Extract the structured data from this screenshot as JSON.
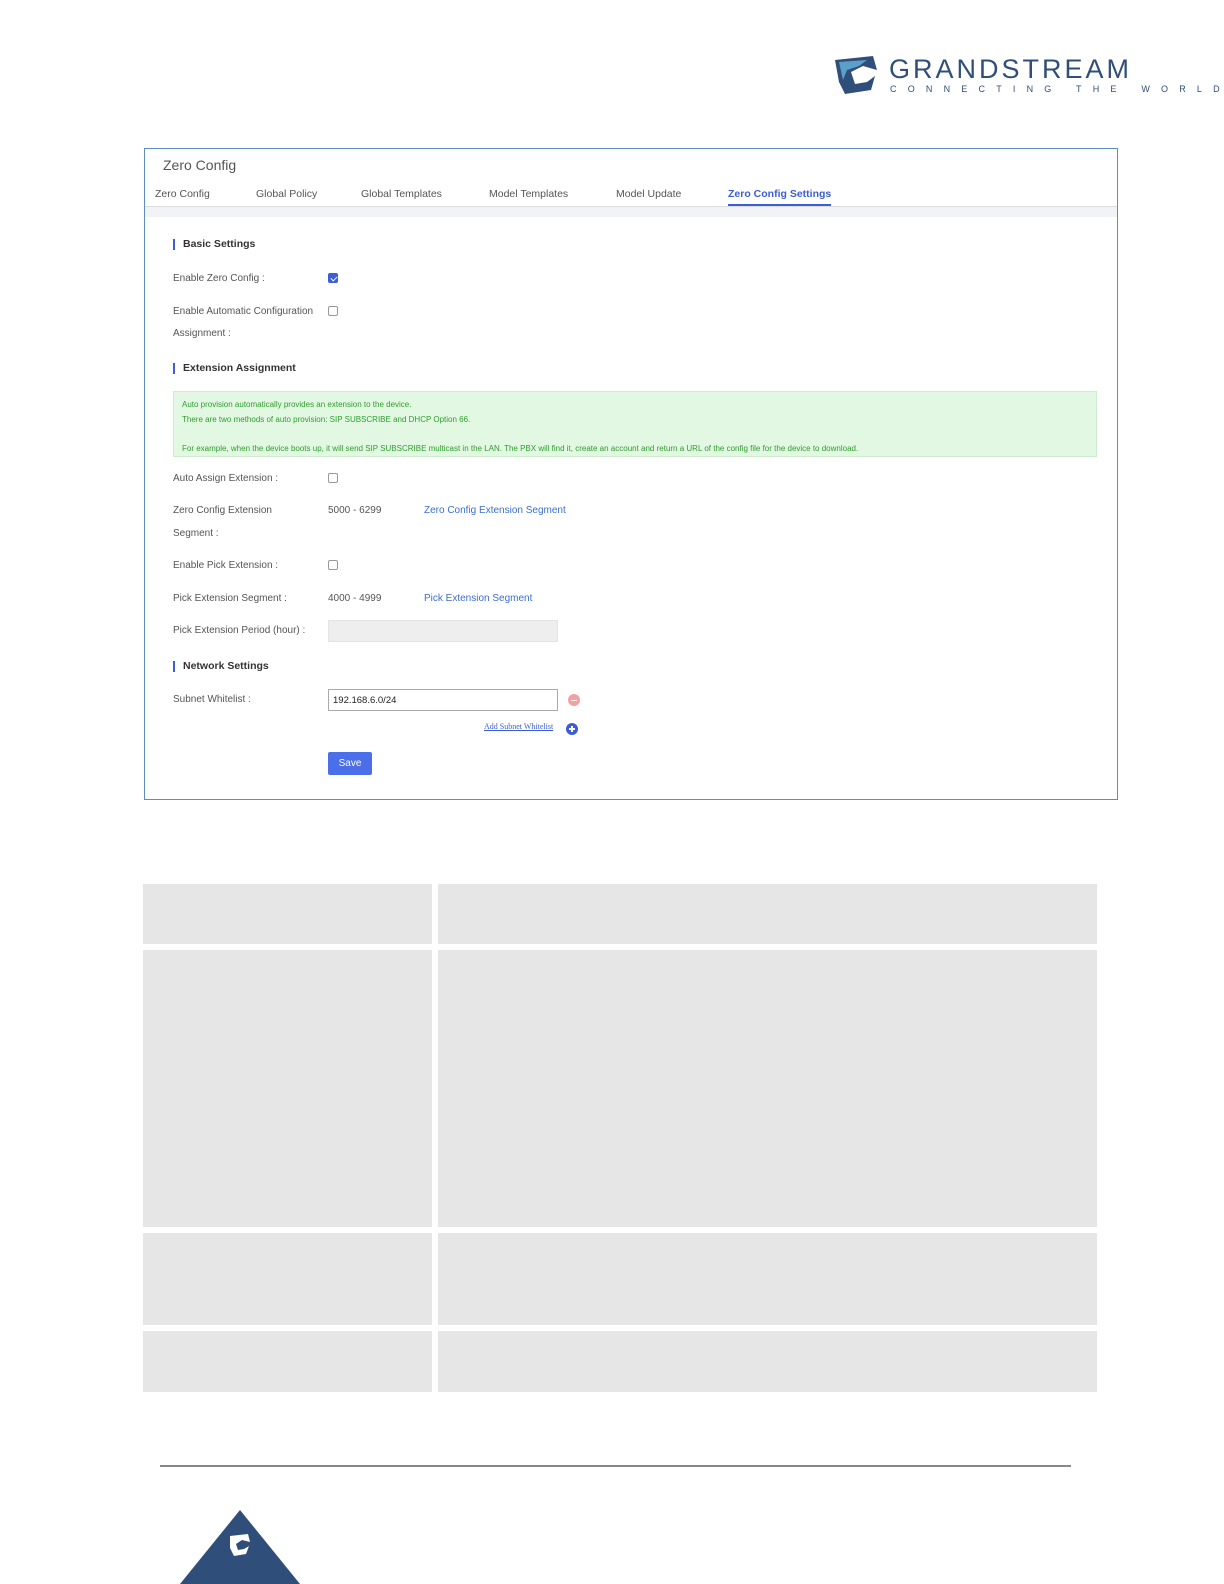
{
  "brand": {
    "name": "GRANDSTREAM",
    "tagline": "CONNECTING THE WORLD",
    "color": "#2f4f7a"
  },
  "panel": {
    "title": "Zero Config",
    "tabs": [
      {
        "label": "Zero Config",
        "active": false
      },
      {
        "label": "Global Policy",
        "active": false
      },
      {
        "label": "Global Templates",
        "active": false
      },
      {
        "label": "Model Templates",
        "active": false
      },
      {
        "label": "Model Update",
        "active": false
      },
      {
        "label": "Zero Config Settings",
        "active": true
      }
    ],
    "accent_color": "#3b5ed6",
    "basic_settings": {
      "heading": "Basic Settings",
      "enable_zero_config_label": "Enable Zero Config :",
      "enable_zero_config": true,
      "enable_auto_config_label_1": "Enable Automatic Configuration",
      "enable_auto_config_label_2": "Assignment :",
      "enable_auto_config": false
    },
    "extension_assignment": {
      "heading": "Extension Assignment",
      "info_lines": [
        "Auto provision automatically provides an extension to the device.",
        "There are two methods of auto provision: SIP SUBSCRIBE and DHCP Option 66.",
        "",
        "For example, when the device boots up, it will send SIP SUBSCRIBE multicast in the LAN. The PBX will find it, create an account and return a URL of the config file for the device to download."
      ],
      "auto_assign_label": "Auto Assign Extension :",
      "auto_assign": false,
      "segment_label_1": "Zero Config Extension",
      "segment_label_2": "Segment :",
      "segment_value": "5000 - 6299",
      "segment_link": "Zero Config Extension Segment",
      "enable_pick_label": "Enable Pick Extension :",
      "enable_pick": false,
      "pick_segment_label": "Pick Extension Segment :",
      "pick_segment_value": "4000 - 4999",
      "pick_segment_link": "Pick Extension Segment",
      "pick_period_label": "Pick Extension Period (hour) :",
      "pick_period_value": ""
    },
    "network_settings": {
      "heading": "Network Settings",
      "subnet_label": "Subnet Whitelist :",
      "subnet_value": "192.168.6.0/24",
      "add_subnet_link": "Add Subnet Whitelist"
    },
    "save_label": "Save"
  }
}
